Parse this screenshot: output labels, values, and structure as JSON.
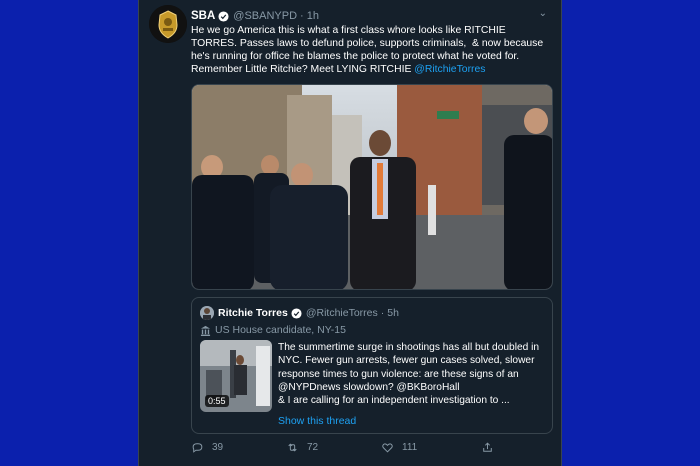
{
  "tweet": {
    "name": "SBA",
    "handle": "@SBANYPD",
    "sep": "·",
    "time": "1h",
    "text": "He we go America this is what a first class whore looks like RITCHIE TORRES. Passes laws to defund police, supports criminals,  & now because he's running for office he blames the police to protect what he voted for. Remember Little Ritchie? Meet LYING RITCHIE ",
    "mention": "@RitchieTorres",
    "icons": {
      "avatar": "sba-badge-icon",
      "verified": "verified-icon",
      "menu": "chevron-down-icon"
    }
  },
  "quote": {
    "name": "Ritchie Torres",
    "handle": "@RitchieTorres",
    "sep": "·",
    "time": "5h",
    "label": "US House candidate, NY-15",
    "text": "The summertime surge in shootings has all but doubled in NYC. Fewer gun arrests, fewer gun cases solved, slower response times to gun violence: are these signs of an @NYPDnews slowdown? @BKBoroHall\n& I are calling for an independent investigation to ...",
    "video_duration": "0:55",
    "show_thread": "Show this thread"
  },
  "actions": {
    "reply_count": "39",
    "retweet_count": "72",
    "like_count": "111"
  },
  "colors": {
    "background": "#15202b",
    "accent": "#1da1f2",
    "muted": "#8899a6",
    "page_border": "#0a1ea8"
  }
}
